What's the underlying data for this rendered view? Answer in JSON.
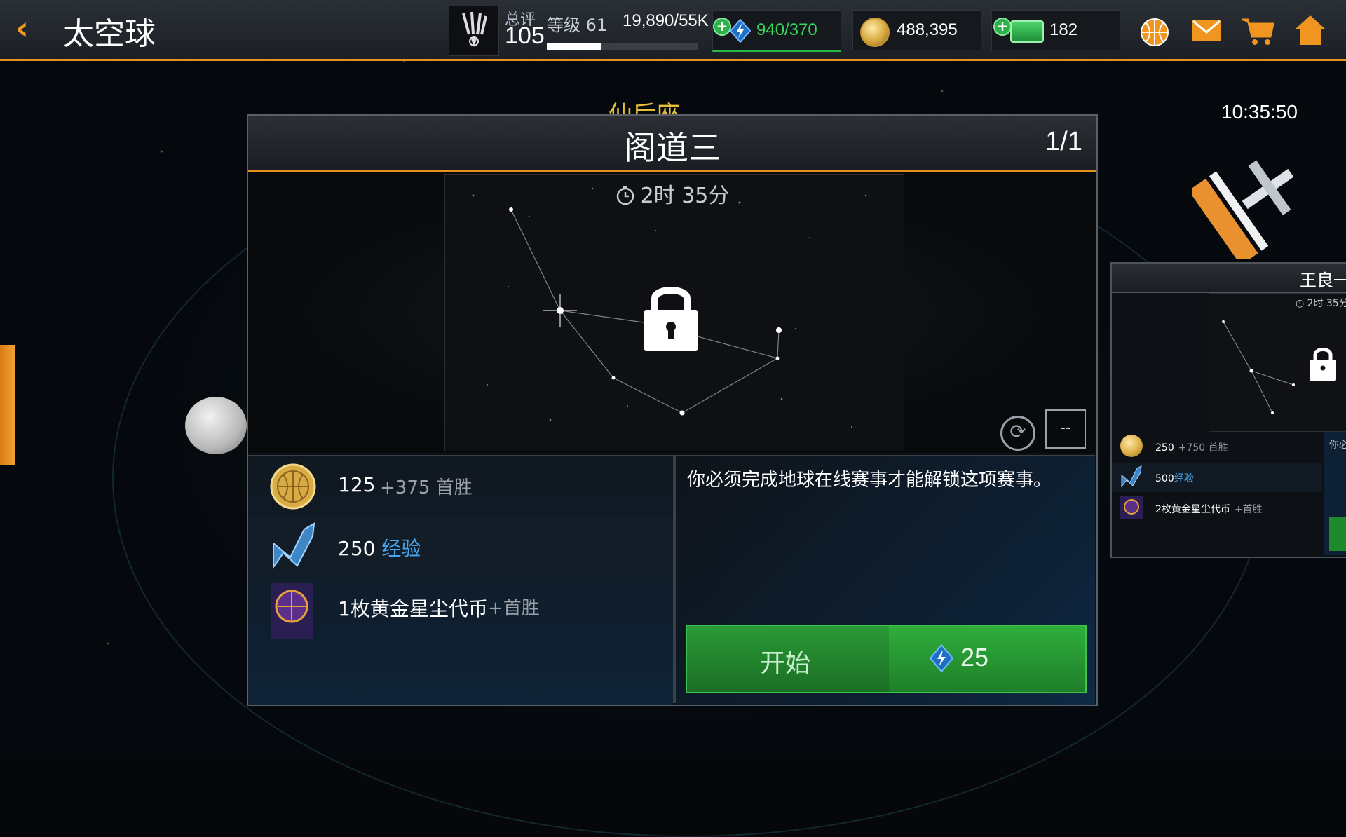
{
  "header": {
    "back_label": "‹",
    "title": "太空球",
    "ovr_label": "总评",
    "ovr_value": "105",
    "level_label": "等级 61",
    "xp_text": "19,890/55K",
    "xp_progress": 0.36,
    "energy": "940/370",
    "coins": "488,395",
    "cash": "182",
    "icons": [
      "basketball-icon",
      "mail-icon",
      "cart-icon",
      "home-icon"
    ]
  },
  "clock": "10:35:50",
  "constellation": "仙后座",
  "panel": {
    "title": "阁道三",
    "page": "1/1",
    "timer": "2时 35分",
    "dash_label": "--",
    "rewards": [
      {
        "icon": "coin-icon",
        "main": "125",
        "extra": "+375 首胜"
      },
      {
        "icon": "xp-arrow-icon",
        "main": "250",
        "main_blue": "经验",
        "extra": ""
      },
      {
        "icon": "gold-stardust-token-icon",
        "main": "1枚黄金星尘代币",
        "extra": "+首胜"
      }
    ],
    "info_text": "你必须完成地球在线赛事才能解锁这项赛事。",
    "start_label": "开始",
    "cost": "25"
  },
  "side_panel": {
    "title": "王良一",
    "timer": "2时 35分",
    "rewards": [
      {
        "main": "250",
        "extra": "+750 首胜"
      },
      {
        "main": "500",
        "main_blue": "经验"
      },
      {
        "main": "2枚黄金星尘代币",
        "extra": "+首胜"
      }
    ],
    "info_cut": "你必"
  },
  "colors": {
    "accent_orange": "#e8901f",
    "start_green": "#2fae3c",
    "xp_blue": "#49a7ef",
    "energy_text": "#37d65a"
  }
}
